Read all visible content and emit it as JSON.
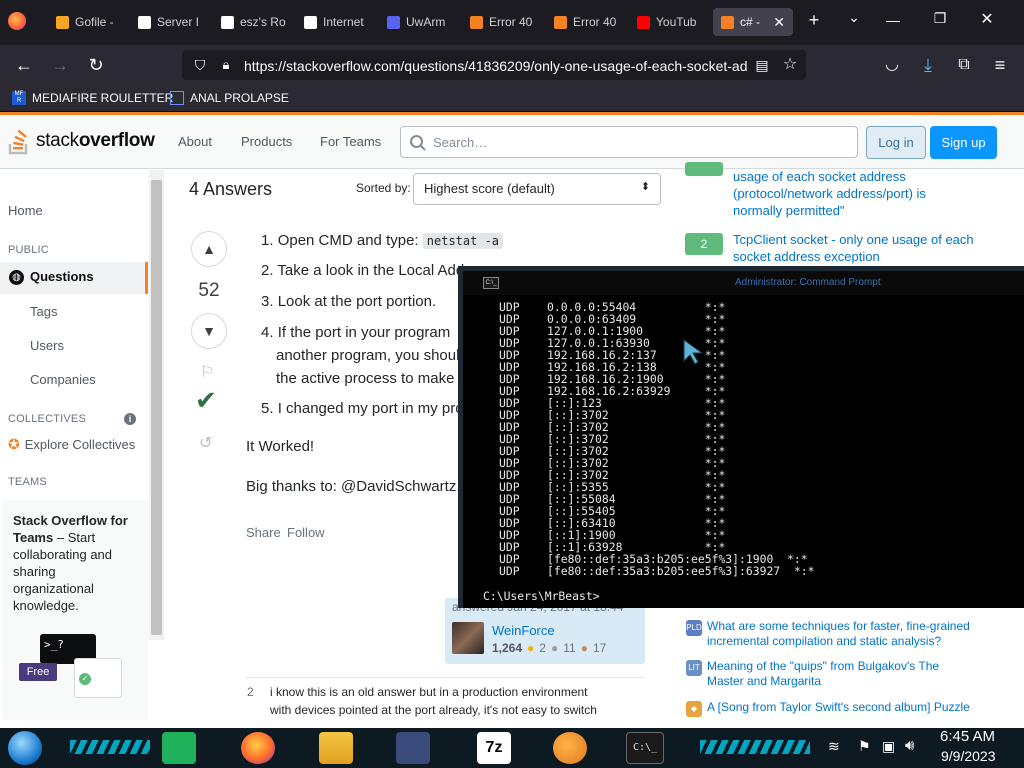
{
  "browser": {
    "tabs": [
      {
        "label": "Gofile -",
        "color": "#f5a623"
      },
      {
        "label": "Server I",
        "color": "#ffffff"
      },
      {
        "label": "esz's Ro",
        "color": "#ffffff"
      },
      {
        "label": "Internet",
        "color": "#ffffff"
      },
      {
        "label": "UwArm",
        "color": "#5865f2"
      },
      {
        "label": "Error 40",
        "color": "#f48225"
      },
      {
        "label": "Error 40",
        "color": "#f48225"
      },
      {
        "label": "YouTub",
        "color": "#ff0000"
      },
      {
        "label": "c# -",
        "color": "#f48225"
      }
    ],
    "url": "https://stackoverflow.com/questions/41836209/only-one-usage-of-each-socket-ad",
    "bookmarks": [
      "MEDIAFIRE ROULETTER",
      "ANAL PROLAPSE"
    ],
    "bookmark_badge": "MF R"
  },
  "so_header": {
    "logo_light": "stack",
    "logo_bold": "overflow",
    "nav": [
      "About",
      "Products",
      "For Teams"
    ],
    "search_placeholder": "Search…",
    "login": "Log in",
    "signup": "Sign up"
  },
  "leftnav": {
    "home": "Home",
    "public_label": "PUBLIC",
    "questions": "Questions",
    "tags": "Tags",
    "users": "Users",
    "companies": "Companies",
    "collectives_label": "COLLECTIVES",
    "explore_collectives": "Explore Collectives",
    "teams_label": "TEAMS",
    "teams_title": "Stack Overflow for Teams",
    "teams_rest": " – Start collaborating and sharing organizational knowledge.",
    "free_badge": "Free",
    "teams_prompt": ">_?"
  },
  "main": {
    "answers_count": "4 Answers",
    "sorted_by": "Sorted by:",
    "sort_value": "Highest score (default)",
    "score": "52",
    "steps": [
      {
        "num": "1.",
        "text": "Open CMD and type: ",
        "code": "netstat -a"
      },
      {
        "num": "2.",
        "text": "Take a look in the Local Add"
      },
      {
        "num": "3.",
        "text": "Look at the port portion."
      },
      {
        "num": "4.",
        "text": "If the port in your program",
        "text2": "another program, you shoul",
        "text3": "the active process to make t"
      },
      {
        "num": "5.",
        "text": "I changed my port in my pro"
      }
    ],
    "it_worked": "It Worked!",
    "big_thanks": "Big thanks to: @DavidSchwartz, @",
    "share": "Share",
    "follow": "Follow",
    "answered": "answered Jan 24, 2017 at 18:44",
    "user_name": "WeinForce",
    "rep": "1,264",
    "gold": "2",
    "silver": "11",
    "bronze": "17",
    "comment_score": "2",
    "comment_text_1": "i know this is an old answer but in a production environment",
    "comment_text_2": "with devices pointed at the port already, it's not easy to switch"
  },
  "right_col": {
    "linked_top": [
      "usage of each socket address",
      "(protocol/network address/port) is",
      "normally permitted\""
    ],
    "linked_badge": "2",
    "linked_2": [
      "TcpClient socket - only one usage of each",
      "socket address exception"
    ],
    "hnq": [
      {
        "icon": "PLD",
        "color": "#5b7fc7",
        "lines": [
          "What are some techniques for faster, fine-grained",
          "incremental compilation and static analysis?"
        ]
      },
      {
        "icon": "LIT",
        "color": "#6a8fc9",
        "lines": [
          "Meaning of the \"quips\" from Bulgakov's The",
          "Master and Margarita"
        ]
      },
      {
        "icon": "◆",
        "color": "#e8a33d",
        "lines": [
          "A [Song from Taylor Swift's second album] Puzzle"
        ]
      }
    ]
  },
  "cmd": {
    "title": "Administrator: Command Prompt",
    "title_icon": "C:\\_",
    "lines": [
      "UDP    0.0.0.0:55404          *:*",
      "UDP    0.0.0.0:63409          *:*",
      "UDP    127.0.0.1:1900         *:*",
      "UDP    127.0.0.1:63930        *:*",
      "UDP    192.168.16.2:137       *:*",
      "UDP    192.168.16.2:138       *:*",
      "UDP    192.168.16.2:1900      *:*",
      "UDP    192.168.16.2:63929     *:*",
      "UDP    [::]:123               *:*",
      "UDP    [::]:3702              *:*",
      "UDP    [::]:3702              *:*",
      "UDP    [::]:3702              *:*",
      "UDP    [::]:3702              *:*",
      "UDP    [::]:3702              *:*",
      "UDP    [::]:3702              *:*",
      "UDP    [::]:5355              *:*",
      "UDP    [::]:55084             *:*",
      "UDP    [::]:55405             *:*",
      "UDP    [::]:63410             *:*",
      "UDP    [::1]:1900             *:*",
      "UDP    [::1]:63928            *:*",
      "UDP    [fe80::def:35a3:b205:ee5f%3]:1900  *:*",
      "UDP    [fe80::def:35a3:b205:ee5f%3]:63927  *:*"
    ],
    "prompt": "C:\\Users\\MrBeast>"
  },
  "taskbar": {
    "time": "6:45 AM",
    "date": "9/9/2023",
    "terminal_label": "C:\\_"
  }
}
